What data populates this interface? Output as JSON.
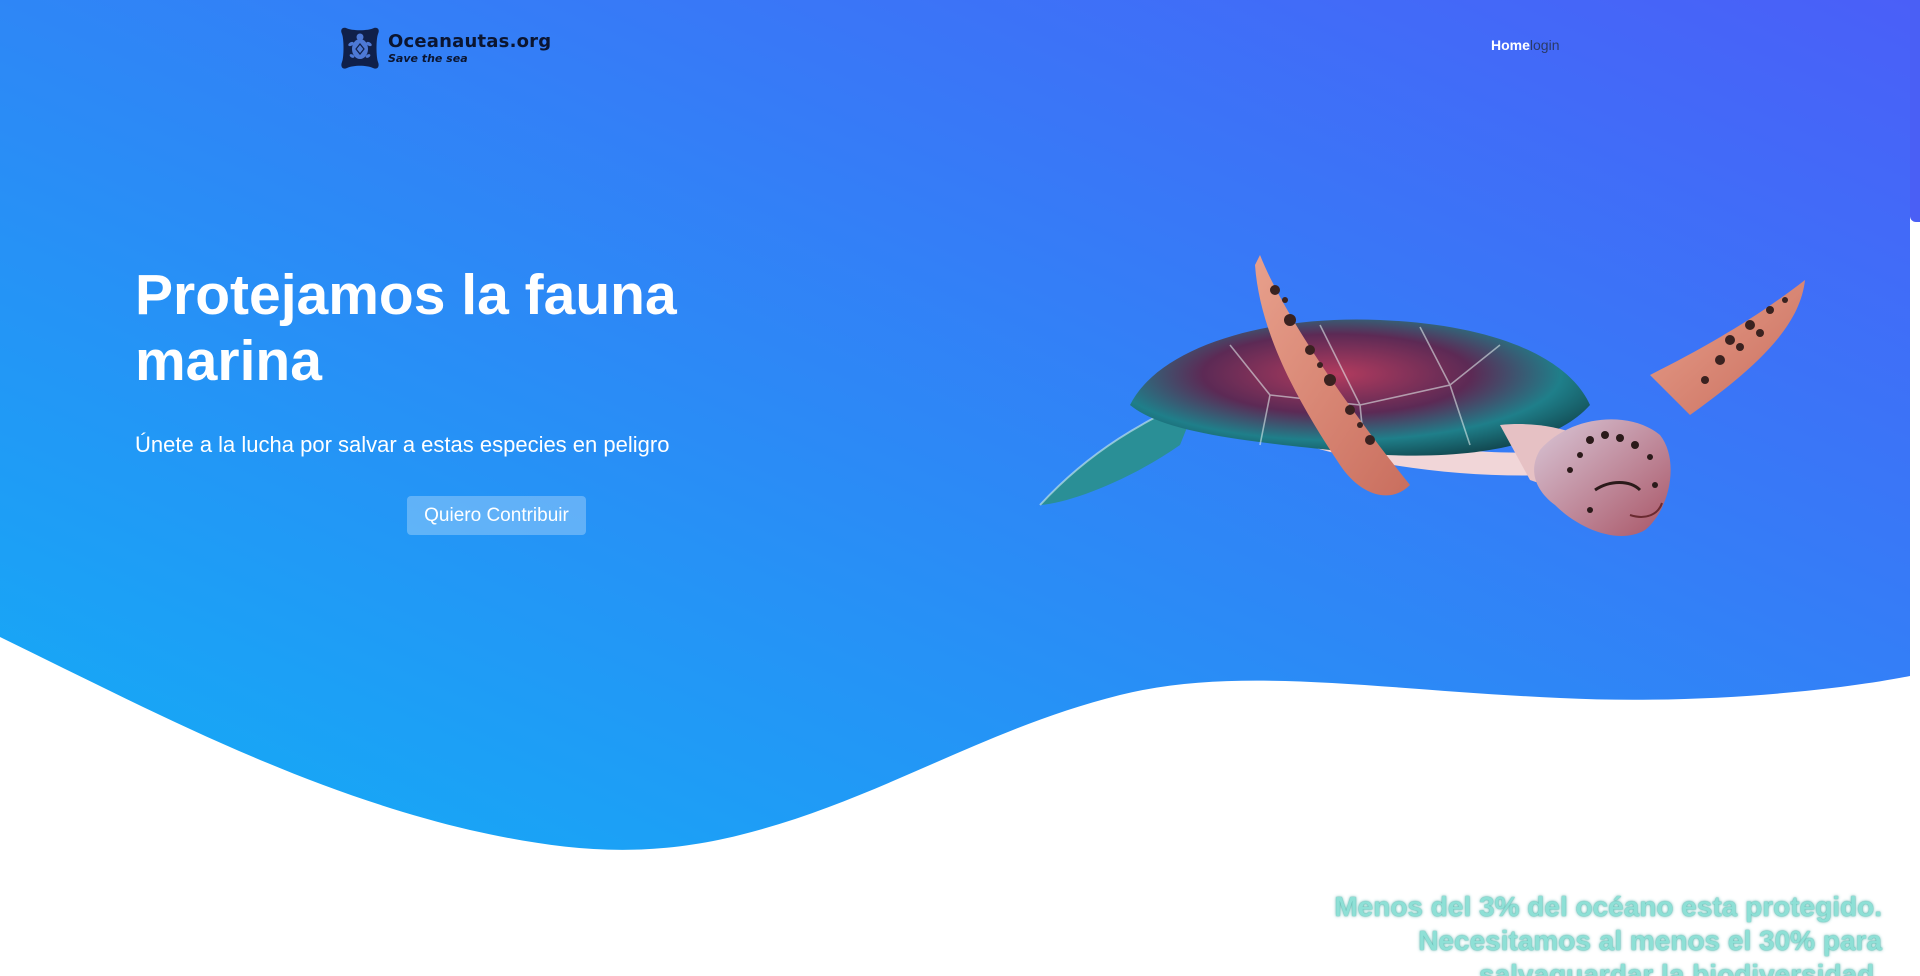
{
  "brand": {
    "name": "Oceanautas.org",
    "tagline": "Save the sea",
    "logo_icon": "turtle-logo-icon"
  },
  "nav": {
    "home": "Home",
    "login": "login"
  },
  "hero": {
    "title": "Protejamos la fauna marina",
    "subtitle": "Únete a la lucha por salvar a estas especies en peligro",
    "cta": "Quiero Contribuir",
    "image": "sea-turtle-image",
    "gradient_start": "#12aef5",
    "gradient_end": "#4a5ff8"
  },
  "stats": {
    "text": "Menos del 3% del océano esta protegido. Necesitamos al menos el 30% para salvaguardar la biodiversidad."
  }
}
